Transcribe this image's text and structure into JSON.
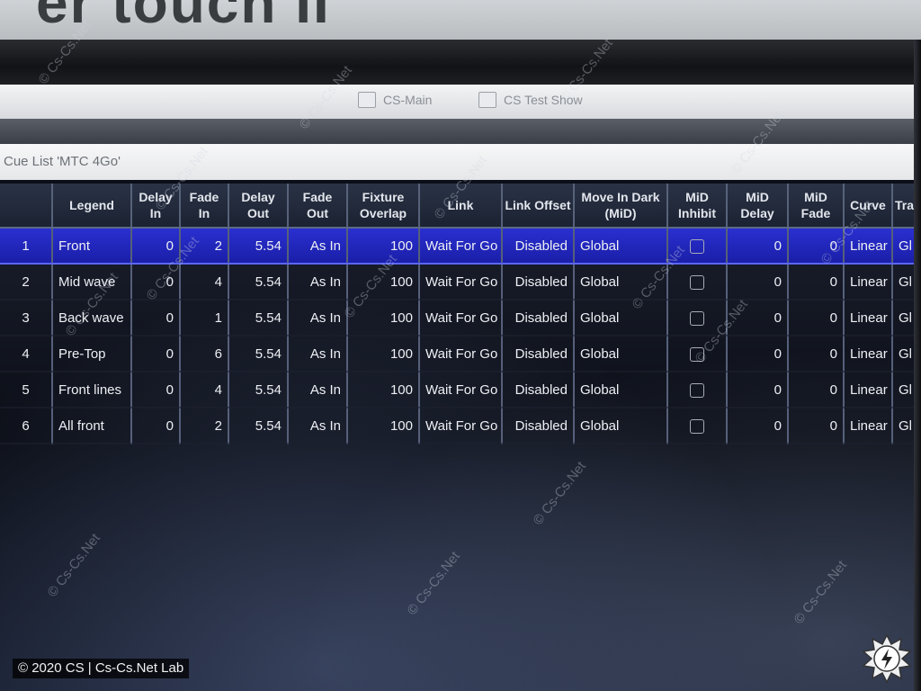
{
  "window_tabs": [
    {
      "label": "CS-Main",
      "icon": "window-icon"
    },
    {
      "label": "CS Test Show",
      "icon": "document-icon"
    }
  ],
  "cue_list_title": "Cue List 'MTC 4Go'",
  "columns": [
    "",
    "Legend",
    "Delay In",
    "Fade In",
    "Delay Out",
    "Fade Out",
    "Fixture Overlap",
    "Link",
    "Link Offset",
    "Move In Dark (MiD)",
    "MiD Inhibit",
    "MiD Delay",
    "MiD Fade",
    "Curve",
    "Track"
  ],
  "rows": [
    {
      "num": "1",
      "legend": "Front",
      "delay_in": "0",
      "fade_in": "2",
      "delay_out": "5.54",
      "fade_out": "As In",
      "overlap": "100",
      "link": "Wait For Go",
      "link_offset": "Disabled",
      "mid": "Global",
      "mid_inhibit": false,
      "mid_delay": "0",
      "mid_fade": "0",
      "curve": "Linear",
      "track": "Gl",
      "selected": true
    },
    {
      "num": "2",
      "legend": "Mid wave",
      "delay_in": "0",
      "fade_in": "4",
      "delay_out": "5.54",
      "fade_out": "As In",
      "overlap": "100",
      "link": "Wait For Go",
      "link_offset": "Disabled",
      "mid": "Global",
      "mid_inhibit": false,
      "mid_delay": "0",
      "mid_fade": "0",
      "curve": "Linear",
      "track": "Gl",
      "selected": false
    },
    {
      "num": "3",
      "legend": "Back wave",
      "delay_in": "0",
      "fade_in": "1",
      "delay_out": "5.54",
      "fade_out": "As In",
      "overlap": "100",
      "link": "Wait For Go",
      "link_offset": "Disabled",
      "mid": "Global",
      "mid_inhibit": false,
      "mid_delay": "0",
      "mid_fade": "0",
      "curve": "Linear",
      "track": "Gl",
      "selected": false
    },
    {
      "num": "4",
      "legend": "Pre-Top",
      "delay_in": "0",
      "fade_in": "6",
      "delay_out": "5.54",
      "fade_out": "As In",
      "overlap": "100",
      "link": "Wait For Go",
      "link_offset": "Disabled",
      "mid": "Global",
      "mid_inhibit": false,
      "mid_delay": "0",
      "mid_fade": "0",
      "curve": "Linear",
      "track": "Gl",
      "selected": false
    },
    {
      "num": "5",
      "legend": "Front lines",
      "delay_in": "0",
      "fade_in": "4",
      "delay_out": "5.54",
      "fade_out": "As In",
      "overlap": "100",
      "link": "Wait For Go",
      "link_offset": "Disabled",
      "mid": "Global",
      "mid_inhibit": false,
      "mid_delay": "0",
      "mid_fade": "0",
      "curve": "Linear",
      "track": "Gl",
      "selected": false
    },
    {
      "num": "6",
      "legend": "All front",
      "delay_in": "0",
      "fade_in": "2",
      "delay_out": "5.54",
      "fade_out": "As In",
      "overlap": "100",
      "link": "Wait For Go",
      "link_offset": "Disabled",
      "mid": "Global",
      "mid_inhibit": false,
      "mid_delay": "0",
      "mid_fade": "0",
      "curve": "Linear",
      "track": "Gl",
      "selected": false
    }
  ],
  "watermark_text": "© Cs-Cs.Net",
  "copyright": "© 2020 CS | Cs-Cs.Net Lab",
  "colors": {
    "selected_row": "#2a2fd0",
    "header_bg": "#1b2232",
    "grid_line": "#56607a"
  }
}
